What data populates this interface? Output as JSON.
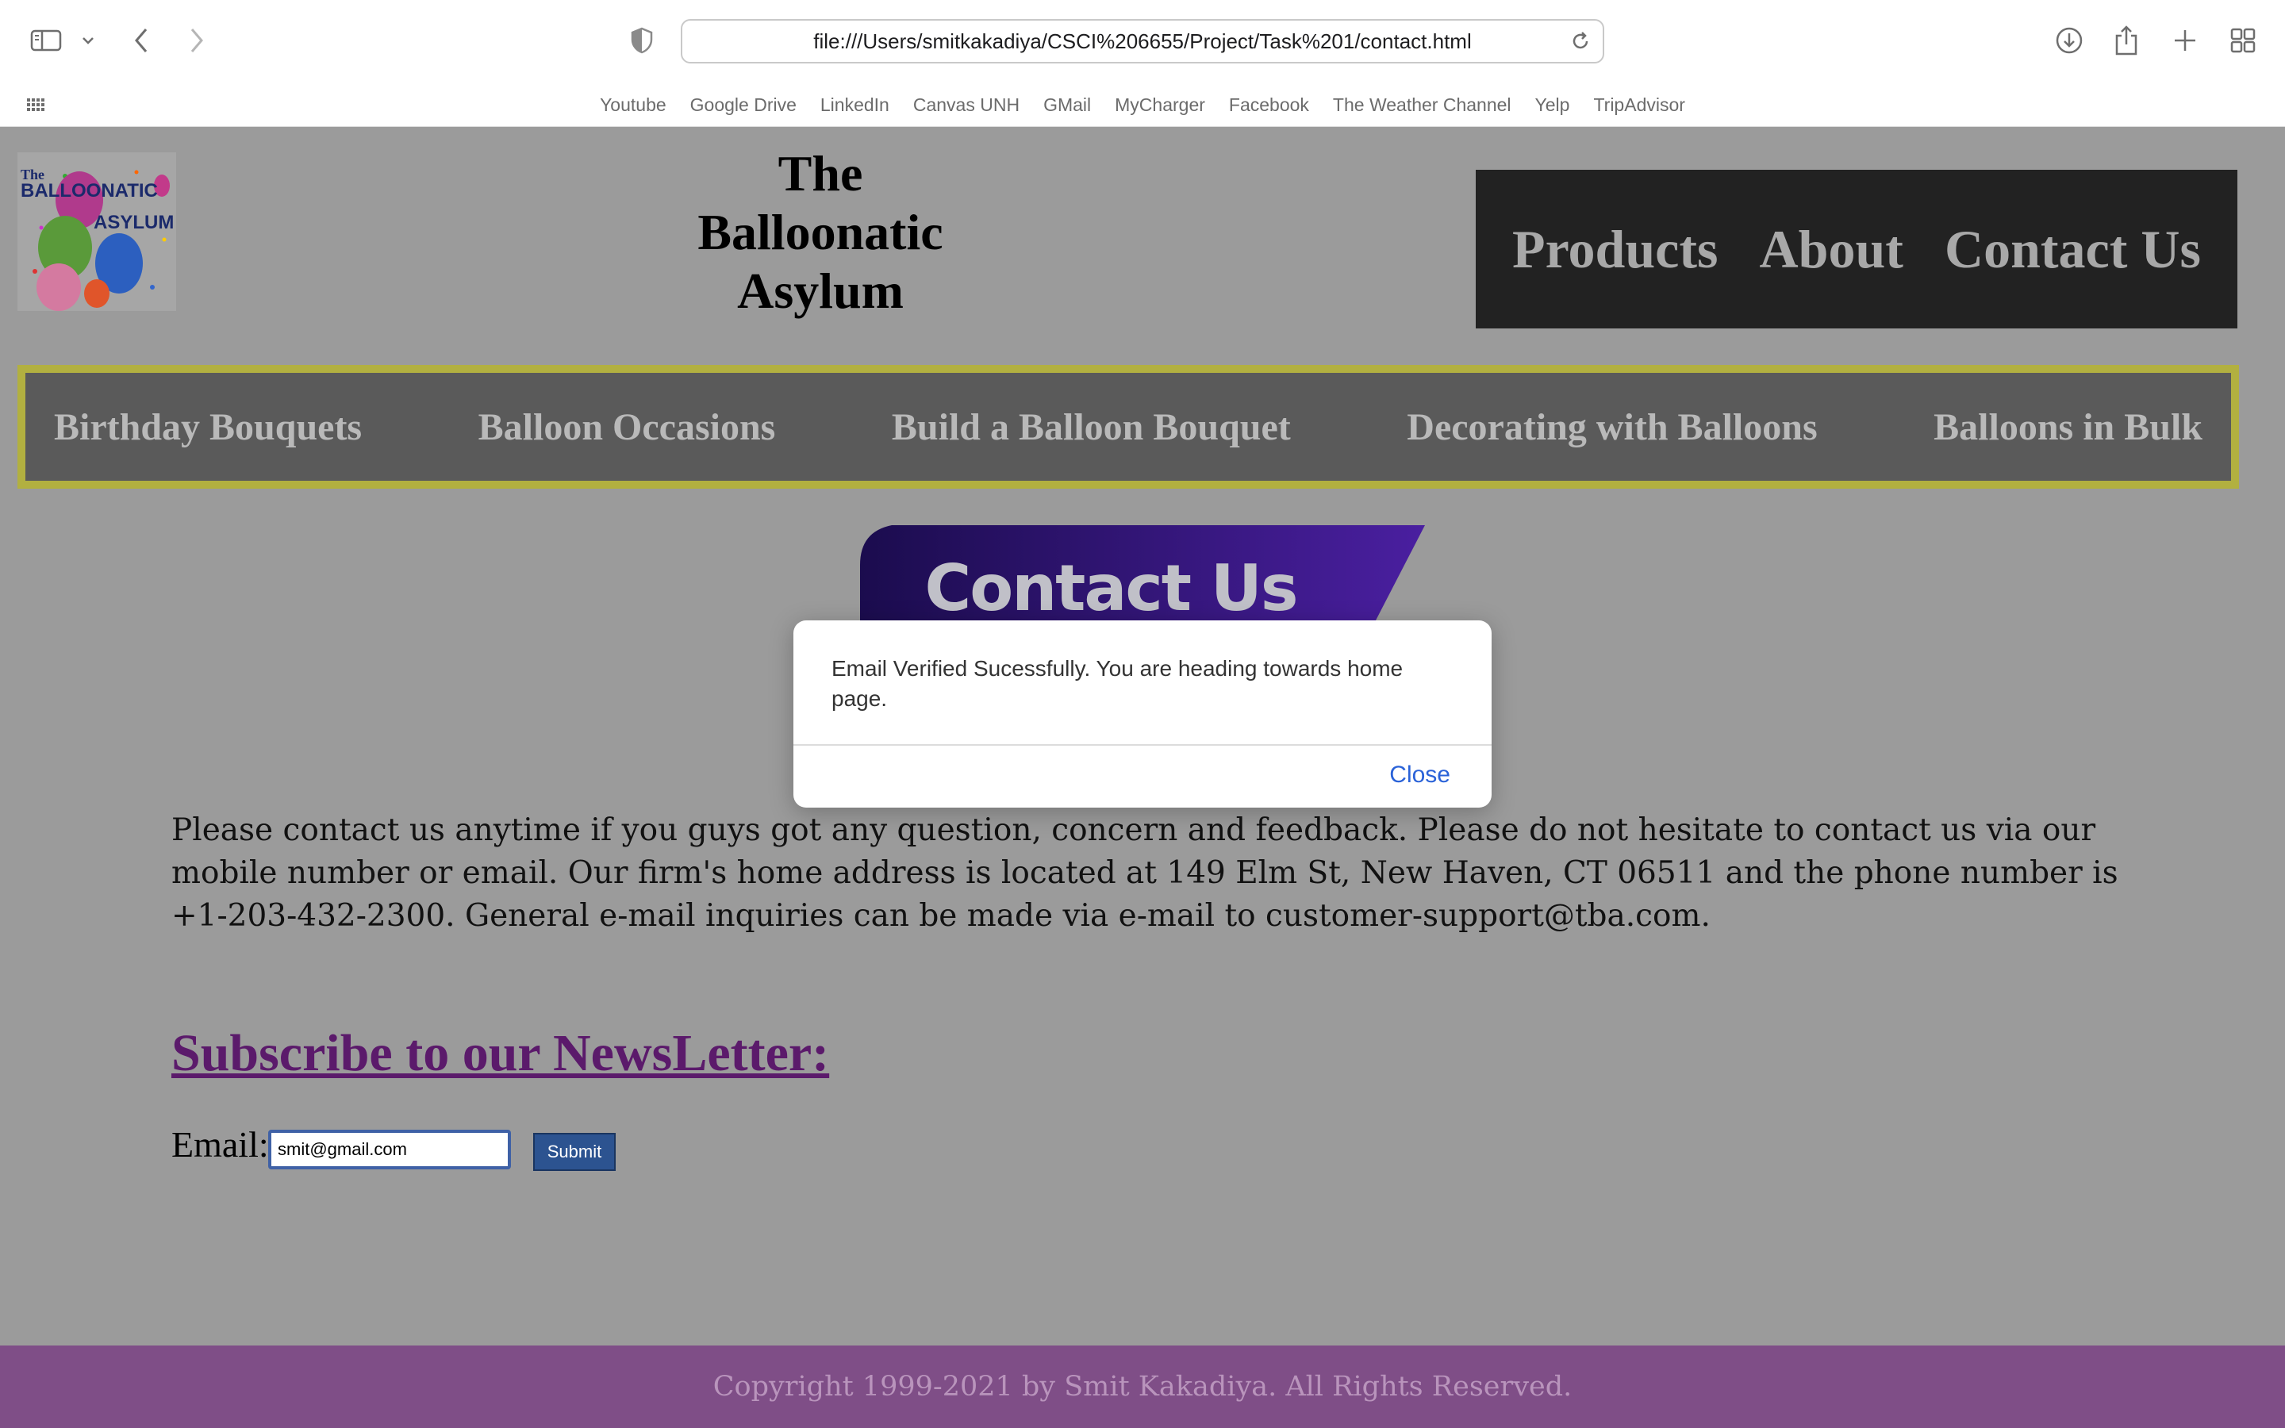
{
  "browser": {
    "url": "file:///Users/smitkakadiya/CSCI%206655/Project/Task%201/contact.html",
    "bookmarks": [
      "Youtube",
      "Google Drive",
      "LinkedIn",
      "Canvas UNH",
      "GMail",
      "MyCharger",
      "Facebook",
      "The Weather Channel",
      "Yelp",
      "TripAdvisor"
    ],
    "icons": [
      "sidebar-icon",
      "chevron-down-icon",
      "back-icon",
      "forward-icon",
      "privacy-shield-icon",
      "reload-icon",
      "download-icon",
      "share-icon",
      "new-tab-icon",
      "tab-overview-icon",
      "grid-icon"
    ]
  },
  "site": {
    "title": "The Balloonatic Asylum",
    "logo_text": [
      "The",
      "BALLOONATIC",
      "ASYLUM"
    ],
    "top_nav": [
      "Products",
      "About",
      "Contact Us"
    ],
    "category_nav": [
      "Birthday Bouquets",
      "Balloon Occasions",
      "Build a Balloon Bouquet",
      "Decorating with Balloons",
      "Balloons in Bulk"
    ],
    "banner_text": "Contact Us"
  },
  "content": {
    "contact_paragraph": "Please contact us anytime if you guys got any question, concern and feedback. Please do not hesitate to contact us via our mobile number or email. Our firm's home address is located at 149 Elm St, New Haven, CT 06511 and the phone number is +1-203-432-2300. General e-mail inquiries can be made via e-mail to customer-support@tba.com.",
    "subscribe_heading": "Subscribe to our NewsLetter:",
    "email_label": "Email:",
    "email_value": "smit@gmail.com",
    "submit_label": "Submit"
  },
  "footer": {
    "copyright": "Copyright 1999-2021 by Smit Kakadiya. All Rights Reserved."
  },
  "dialog": {
    "message": "Email Verified Sucessfully. You are heading towards home page.",
    "close_label": "Close"
  },
  "colors": {
    "page_bg": "#9b9b9b",
    "top_nav_bg": "#222222",
    "category_nav_bg": "#5a5a5a",
    "category_nav_border": "#b2b040",
    "subscribe_heading": "#5b1a6b",
    "footer_bg": "#7f4e87",
    "dialog_link": "#2a62d8"
  }
}
